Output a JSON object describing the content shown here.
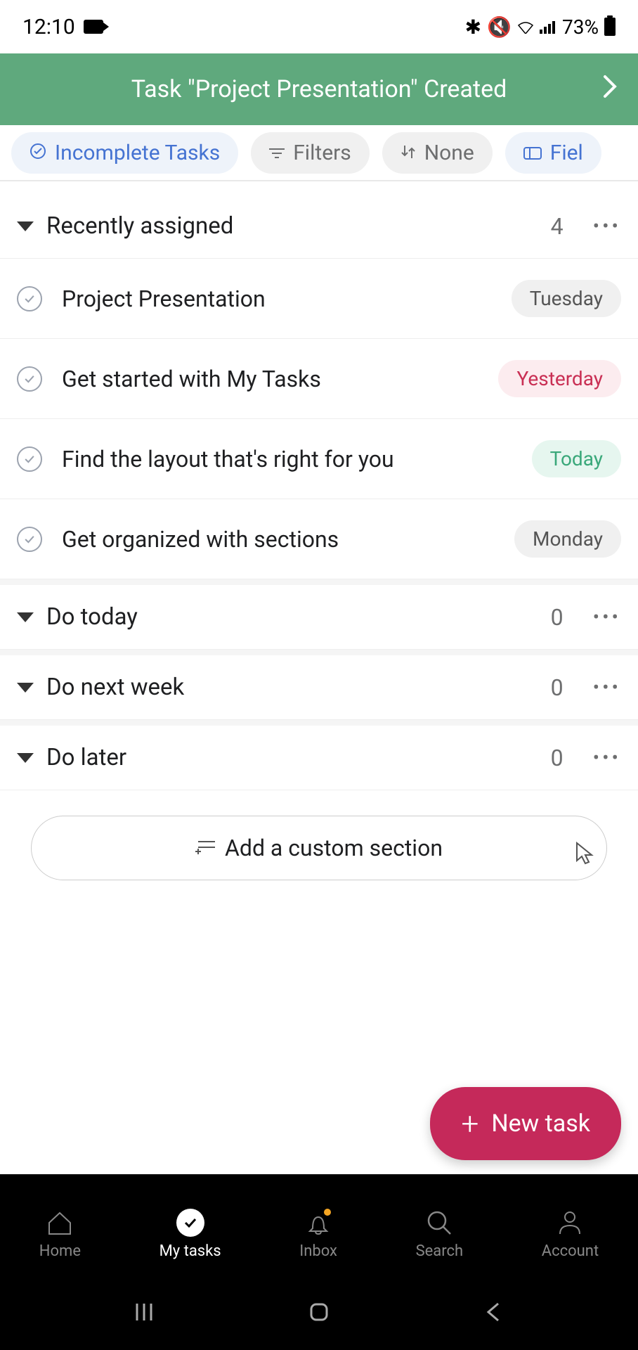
{
  "status_bar": {
    "time": "12:10",
    "battery": "73%"
  },
  "toast": {
    "message": "Task \"Project Presentation\" Created"
  },
  "filters": {
    "incomplete": "Incomplete Tasks",
    "filters_label": "Filters",
    "sort_label": "None",
    "fields_label": "Fiel"
  },
  "sections": [
    {
      "title": "Recently assigned",
      "count": "4",
      "tasks": [
        {
          "title": "Project Presentation",
          "date": "Tuesday",
          "badge_type": "default"
        },
        {
          "title": "Get started with My Tasks",
          "date": "Yesterday",
          "badge_type": "past"
        },
        {
          "title": "Find the layout that's right for you",
          "date": "Today",
          "badge_type": "today"
        },
        {
          "title": "Get organized with sections",
          "date": "Monday",
          "badge_type": "default"
        }
      ]
    },
    {
      "title": "Do today",
      "count": "0",
      "tasks": []
    },
    {
      "title": "Do next week",
      "count": "0",
      "tasks": []
    },
    {
      "title": "Do later",
      "count": "0",
      "tasks": []
    }
  ],
  "add_section_label": "Add a custom section",
  "fab_label": "New task",
  "bottom_nav": {
    "home": "Home",
    "my_tasks": "My tasks",
    "inbox": "Inbox",
    "search": "Search",
    "account": "Account"
  }
}
